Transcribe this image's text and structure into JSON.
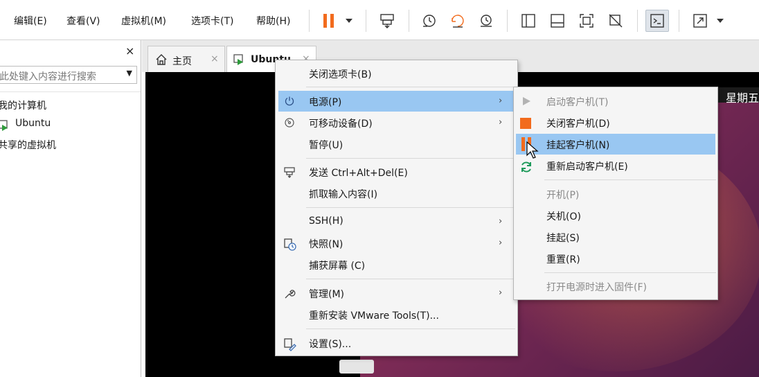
{
  "menubar": {
    "items": [
      "编辑(E)",
      "查看(V)",
      "虚拟机(M)",
      "选项卡(T)",
      "帮助(H)"
    ]
  },
  "toolbar_icons": [
    "pause-icon",
    "dropdown-arrow-icon",
    "send-ctrl-alt-del-icon",
    "snapshot-take-icon",
    "snapshot-revert-icon",
    "snapshot-manager-icon",
    "show-library-icon",
    "show-thumbnail-bar-icon",
    "fullscreen-icon",
    "unity-icon",
    "console-view-icon",
    "stretch-icon",
    "stretch-dropdown-icon"
  ],
  "library": {
    "close": "×",
    "search_placeholder": "此处键入内容进行搜索",
    "tree": [
      "我的计算机",
      "Ubuntu",
      "共享的虚拟机"
    ]
  },
  "tabs": [
    {
      "label": "主页",
      "close": "×"
    },
    {
      "label": "Ubuntu",
      "close": "×"
    }
  ],
  "guest": {
    "weekday": "星期五"
  },
  "context_menu": {
    "items": [
      {
        "label": "关闭选项卡(B)"
      },
      {
        "label": "电源(P)",
        "arrow": "›"
      },
      {
        "label": "可移动设备(D)",
        "arrow": "›"
      },
      {
        "label": "暂停(U)"
      },
      {
        "label": "发送 Ctrl+Alt+Del(E)"
      },
      {
        "label": "抓取输入内容(I)"
      },
      {
        "label": "SSH(H)",
        "arrow": "›"
      },
      {
        "label": "快照(N)",
        "arrow": "›"
      },
      {
        "label": "捕获屏幕 (C)"
      },
      {
        "label": "管理(M)",
        "arrow": "›"
      },
      {
        "label": "重新安装 VMware Tools(T)..."
      },
      {
        "label": "设置(S)..."
      }
    ]
  },
  "power_submenu": {
    "items": [
      {
        "label": "启动客户机(T)",
        "disabled": true
      },
      {
        "label": "关闭客户机(D)"
      },
      {
        "label": "挂起客户机(N)",
        "highlighted": true
      },
      {
        "label": "重新启动客户机(E)"
      },
      {
        "label": "开机(P)",
        "disabled": true
      },
      {
        "label": "关机(O)"
      },
      {
        "label": "挂起(S)"
      },
      {
        "label": "重置(R)"
      },
      {
        "label": "打开电源时进入固件(F)",
        "disabled": true
      }
    ]
  },
  "colors": {
    "accent_orange": "#f26b1d",
    "highlight_blue": "#99c7f2",
    "toolbar_blue": "#3d6fb5",
    "refresh_green": "#1d9a5a"
  }
}
